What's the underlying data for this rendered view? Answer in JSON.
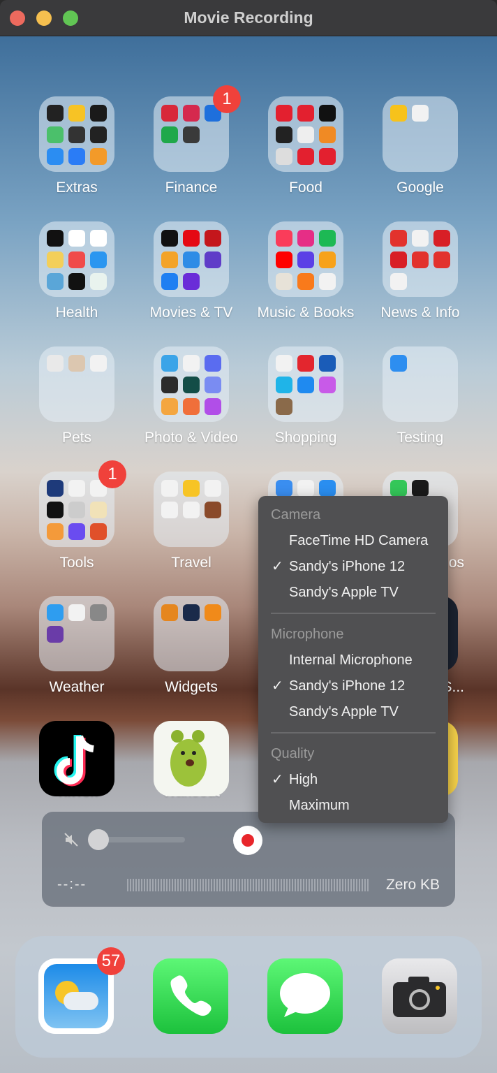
{
  "window": {
    "title": "Movie Recording",
    "traffic_lights": [
      "#ed6a5e",
      "#f5bf4f",
      "#61c554"
    ]
  },
  "folders": [
    {
      "label": "Extras",
      "minis": [
        "#222",
        "#f7c325",
        "#1a1a1a",
        "#4bc06b",
        "#333",
        "#222",
        "#2b8df2",
        "#2a7cf6",
        "#f39a29"
      ]
    },
    {
      "label": "Finance",
      "badge": "1",
      "minis": [
        "#d8283a",
        "#d5294e",
        "#1e6fdc",
        "#1fa84a",
        "#3a3a3a"
      ]
    },
    {
      "label": "Food",
      "minis": [
        "#e3202f",
        "#e3202f",
        "#111",
        "#222",
        "#eee",
        "#f08a24",
        "#ddd",
        "#e3202f",
        "#e3202f"
      ]
    },
    {
      "label": "Google",
      "minis": [
        "#f7c21b",
        "#f2f2f2"
      ]
    },
    {
      "label": "Health",
      "minis": [
        "#111",
        "#fff",
        "#fff",
        "#f3cf5a",
        "#f04a4a",
        "#2b96f0",
        "#5aa6d8",
        "#111",
        "#e9f3ee"
      ]
    },
    {
      "label": "Movies & TV",
      "minis": [
        "#111",
        "#e50914",
        "#c4161c",
        "#f3a328",
        "#2e8ce6",
        "#5f3cc8",
        "#1e7ff2",
        "#6a2cd8"
      ]
    },
    {
      "label": "Music & Books",
      "minis": [
        "#fa3c5a",
        "#e62e86",
        "#1db954",
        "#ff0000",
        "#5b40e6",
        "#f7a21a",
        "#e7e2d8",
        "#f97a1b",
        "#f2f2f2"
      ]
    },
    {
      "label": "News & Info",
      "minis": [
        "#e2322d",
        "#f2f2f2",
        "#d81f26",
        "#d81f26",
        "#e2322d",
        "#e2322d",
        "#f2f2f2"
      ]
    },
    {
      "label": "Pets",
      "minis": [
        "#e9e9e9",
        "#dcc7b0",
        "#f2f2f2"
      ]
    },
    {
      "label": "Photo & Video",
      "minis": [
        "#3ba4e8",
        "#f2f2f2",
        "#5a6cf0",
        "#2b2b2b",
        "#134d47",
        "#7a8cf2",
        "#f4a640",
        "#f06f3a",
        "#b14ee8"
      ]
    },
    {
      "label": "Shopping",
      "minis": [
        "#f2f2f2",
        "#e3262e",
        "#1a5cb8",
        "#1fb4e8",
        "#1f8af0",
        "#c85ae8",
        "#8a6a4a"
      ]
    },
    {
      "label": "Testing",
      "minis": [
        "#2d8ef0"
      ]
    },
    {
      "label": "Tools",
      "badge": "1",
      "minis": [
        "#1e3a7a",
        "#f2f2f2",
        "#f2f2f2",
        "#111",
        "#ccc",
        "#f1e2b8",
        "#f49a3a",
        "#6a4cf0",
        "#e0502a"
      ]
    },
    {
      "label": "Travel",
      "minis": [
        "#f2f2f2",
        "#f7c425",
        "#f2f2f2",
        "#f2f2f2",
        "#f2f2f2",
        "#8a4a2a"
      ]
    },
    {
      "label": "",
      "minis": [
        "#3a8ef0",
        "#f2f2f2",
        "#2a8ef0"
      ]
    },
    {
      "label": "os",
      "minis": [
        "#34c759",
        "#1a1a1a"
      ]
    },
    {
      "label": "Weather",
      "minis": [
        "#2e9df0",
        "#f2f2f2",
        "#888",
        "#6a3ca8"
      ]
    },
    {
      "label": "Widgets",
      "minis": [
        "#e5861e",
        "#1a2a4a",
        "#f08a1a"
      ]
    },
    {
      "label": "",
      "minis": []
    },
    {
      "label": "nS...",
      "minis": []
    }
  ],
  "apps_row": [
    {
      "label": "TikTok",
      "name": "tiktok"
    },
    {
      "label": "Wakeout",
      "name": "wakeout"
    }
  ],
  "menu": {
    "sections": [
      {
        "header": "Camera",
        "items": [
          {
            "label": "FaceTime HD Camera",
            "checked": false
          },
          {
            "label": "Sandy's iPhone 12",
            "checked": true
          },
          {
            "label": "Sandy's Apple TV",
            "checked": false
          }
        ]
      },
      {
        "header": "Microphone",
        "items": [
          {
            "label": "Internal Microphone",
            "checked": false
          },
          {
            "label": "Sandy's iPhone 12",
            "checked": true
          },
          {
            "label": "Sandy's Apple TV",
            "checked": false
          }
        ]
      },
      {
        "header": "Quality",
        "items": [
          {
            "label": "High",
            "checked": true
          },
          {
            "label": "Maximum",
            "checked": false
          }
        ]
      }
    ],
    "check": "✓"
  },
  "controls": {
    "volume": 0,
    "time": "--:--",
    "size": "Zero KB",
    "record_color": "#e8262b"
  },
  "dock": {
    "weather_badge": "57",
    "apps": [
      "weather",
      "phone",
      "messages",
      "camera"
    ]
  }
}
